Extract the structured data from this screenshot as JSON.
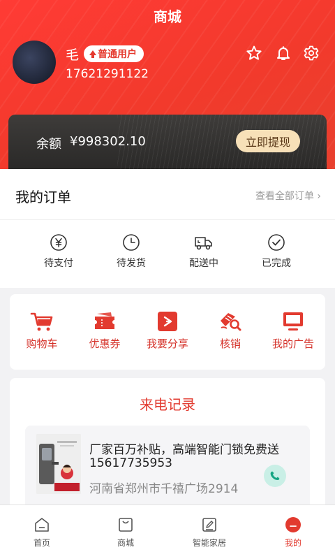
{
  "header": {
    "title": "商城",
    "user": {
      "name": "毛",
      "badge": "普通用户",
      "phone": "17621291122"
    },
    "icons": [
      "star-icon",
      "bell-icon",
      "gear-icon"
    ]
  },
  "balance": {
    "label": "余额",
    "value": "¥998302.10",
    "withdraw_label": "立即提现"
  },
  "orders": {
    "title": "我的订单",
    "view_all": "查看全部订单",
    "items": [
      {
        "label": "待支付",
        "icon": "yuan-icon"
      },
      {
        "label": "待发货",
        "icon": "clock-icon"
      },
      {
        "label": "配送中",
        "icon": "truck-icon"
      },
      {
        "label": "已完成",
        "icon": "check-circle-icon"
      }
    ]
  },
  "tools": {
    "items": [
      {
        "label": "购物车",
        "icon": "cart-icon"
      },
      {
        "label": "优惠券",
        "icon": "coupon-icon"
      },
      {
        "label": "我要分享",
        "icon": "share-icon"
      },
      {
        "label": "核销",
        "icon": "verify-icon"
      },
      {
        "label": "我的广告",
        "icon": "monitor-icon"
      }
    ]
  },
  "calls": {
    "title": "来电记录",
    "entry": {
      "title": "厂家百万补贴，高端智能门锁免费送",
      "phone": "15617735953",
      "address": "河南省郑州市千禧广场2914"
    }
  },
  "nav": {
    "items": [
      {
        "label": "首页",
        "icon": "home-icon"
      },
      {
        "label": "商城",
        "icon": "bag-icon"
      },
      {
        "label": "智能家居",
        "icon": "edit-icon"
      },
      {
        "label": "我的",
        "icon": "profile-icon"
      }
    ],
    "active": "我的"
  },
  "colors": {
    "accent": "#e23a2f",
    "header_bg": "#f23a2c",
    "card_dark": "#2f2e2d",
    "withdraw_bg": "#f7e0b8"
  }
}
